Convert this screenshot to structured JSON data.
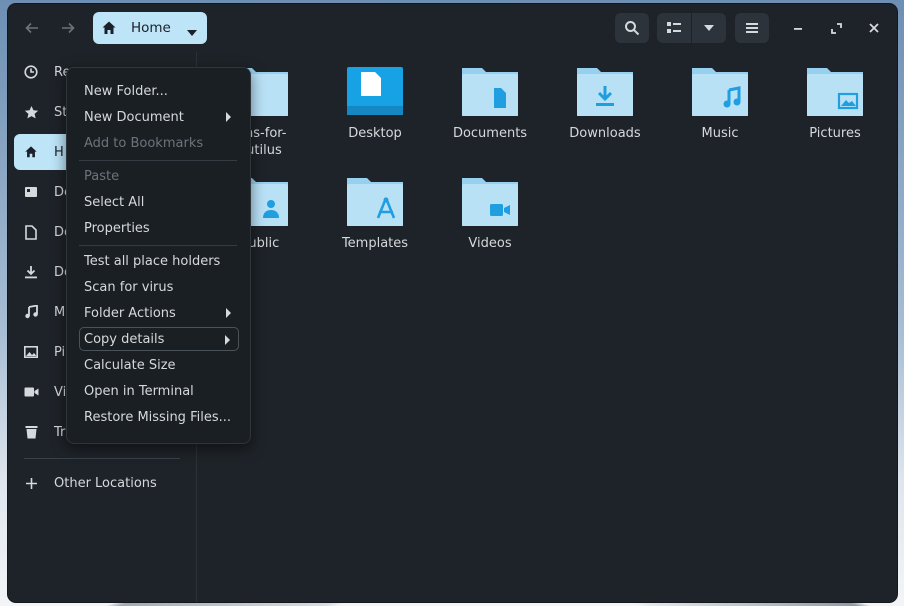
{
  "window": {
    "path_label": "Home",
    "search_icon": "search-icon",
    "view_icon": "list-view-icon",
    "menu_icon": "hamburger-icon"
  },
  "colors": {
    "accent": "#bde4f7",
    "folder_body": "#b9e1f6",
    "folder_tab": "#97d0ee",
    "folder_glyph": "#1f9ee0",
    "desktop_folder": "#17a2e6",
    "window_bg": "#1e2329"
  },
  "sidebar": {
    "items": [
      {
        "label": "Re",
        "icon": "recent-icon"
      },
      {
        "label": "St",
        "icon": "star-icon"
      },
      {
        "label": "H",
        "icon": "home-icon"
      },
      {
        "label": "De",
        "icon": "desktop-icon"
      },
      {
        "label": "Do",
        "icon": "document-icon"
      },
      {
        "label": "Do",
        "icon": "download-icon"
      },
      {
        "label": "M",
        "icon": "music-icon"
      },
      {
        "label": "Pi",
        "icon": "picture-icon"
      },
      {
        "label": "Vi",
        "icon": "video-icon"
      },
      {
        "label": "Tr",
        "icon": "trash-icon"
      }
    ],
    "other_locations": "Other Locations"
  },
  "files": [
    {
      "name_line1": "ions-for-",
      "name_line2": "autilus",
      "glyph": "none"
    },
    {
      "name_line1": "Desktop",
      "name_line2": "",
      "glyph": "desktop"
    },
    {
      "name_line1": "Documents",
      "name_line2": "",
      "glyph": "document"
    },
    {
      "name_line1": "Downloads",
      "name_line2": "",
      "glyph": "download"
    },
    {
      "name_line1": "Music",
      "name_line2": "",
      "glyph": "music"
    },
    {
      "name_line1": "Pictures",
      "name_line2": "",
      "glyph": "picture"
    },
    {
      "name_line1": "Public",
      "name_line2": "",
      "glyph": "person"
    },
    {
      "name_line1": "Templates",
      "name_line2": "",
      "glyph": "template"
    },
    {
      "name_line1": "Videos",
      "name_line2": "",
      "glyph": "video"
    }
  ],
  "context_menu": {
    "items": [
      {
        "label": "New Folder...",
        "disabled": false,
        "submenu": false
      },
      {
        "label": "New Document",
        "disabled": false,
        "submenu": true
      },
      {
        "label": "Add to Bookmarks",
        "disabled": true,
        "submenu": false
      },
      {
        "label": "Paste",
        "disabled": true,
        "submenu": false
      },
      {
        "label": "Select All",
        "disabled": false,
        "submenu": false
      },
      {
        "label": "Properties",
        "disabled": false,
        "submenu": false
      },
      {
        "label": "Test all place holders",
        "disabled": false,
        "submenu": false
      },
      {
        "label": "Scan for virus",
        "disabled": false,
        "submenu": false
      },
      {
        "label": "Folder Actions",
        "disabled": false,
        "submenu": true
      },
      {
        "label": "Copy details",
        "disabled": false,
        "submenu": true
      },
      {
        "label": "Calculate Size",
        "disabled": false,
        "submenu": false
      },
      {
        "label": "Open in Terminal",
        "disabled": false,
        "submenu": false
      },
      {
        "label": "Restore Missing Files...",
        "disabled": false,
        "submenu": false
      }
    ]
  }
}
